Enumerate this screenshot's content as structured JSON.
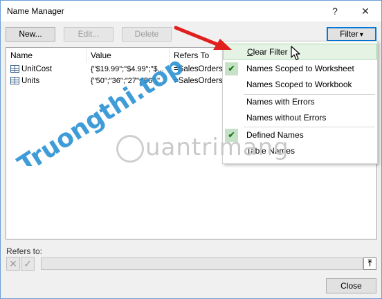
{
  "window": {
    "title": "Name Manager",
    "help_glyph": "?",
    "close_glyph": "✕"
  },
  "toolbar": {
    "new_label": "New...",
    "edit_label": "Edit...",
    "delete_label": "Delete",
    "filter_label": "Filter",
    "filter_arrow": "▾"
  },
  "columns": [
    "Name",
    "Value",
    "Refers To"
  ],
  "rows": [
    {
      "name": "UnitCost",
      "value": "{\"$19.99\";\"$4.99\";\"$...",
      "refers_to": "=SalesOrders!"
    },
    {
      "name": "Units",
      "value": "{\"50\";\"36\";\"27\";\"56\";\"...",
      "refers_to": "=SalesOrders!"
    }
  ],
  "filter_menu": {
    "items": [
      {
        "label": "Clear Filter",
        "checked": false,
        "highlighted": true
      },
      {
        "label": "Names Scoped to Worksheet",
        "checked": true
      },
      {
        "label": "Names Scoped to Workbook",
        "checked": false
      },
      {
        "label": "Names with Errors",
        "checked": false
      },
      {
        "label": "Names without Errors",
        "checked": false
      },
      {
        "label": "Defined Names",
        "checked": true
      },
      {
        "label": "Table Names",
        "checked": false
      }
    ],
    "check_glyph": "✔"
  },
  "refers": {
    "label": "Refers to:",
    "cancel_glyph": "✕",
    "confirm_glyph": "✓",
    "collapse_glyph": "⤒"
  },
  "footer": {
    "close_label": "Close"
  },
  "watermarks": {
    "side": "Truongthi.top",
    "center": "uantrimang"
  },
  "colors": {
    "accent": "#0078d7",
    "check_bg": "#c6e2c6",
    "highlight_bg": "#e5f3e5",
    "watermark_blue": "#1f8bd0",
    "arrow_red": "#e0201e"
  }
}
